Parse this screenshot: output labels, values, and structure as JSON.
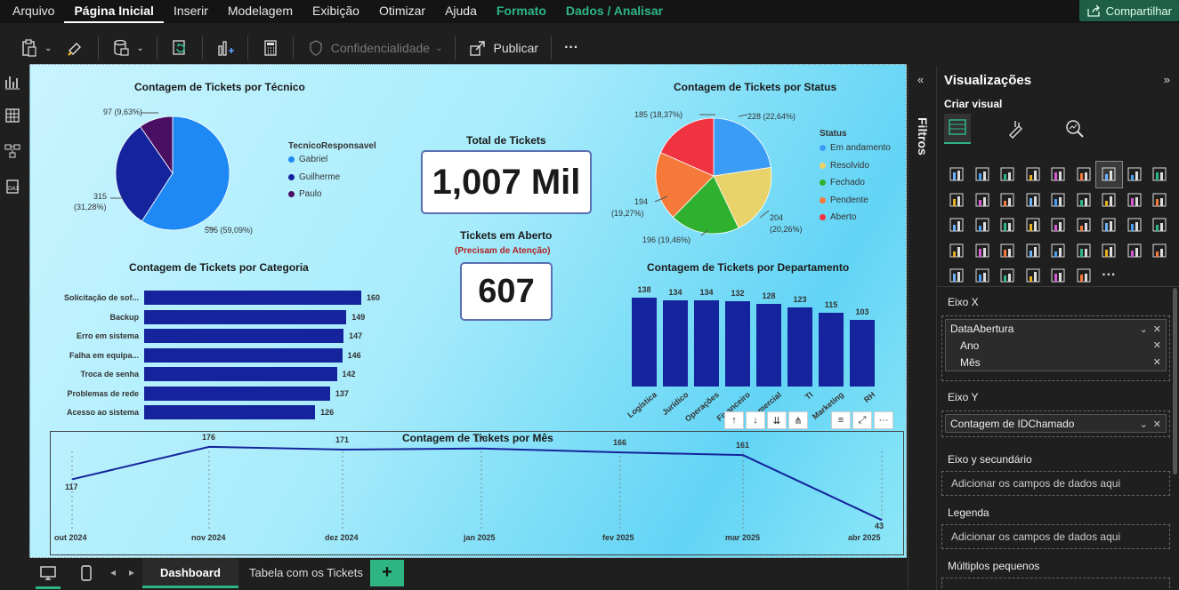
{
  "menu": {
    "items": [
      "Arquivo",
      "Página Inicial",
      "Inserir",
      "Modelagem",
      "Exibição",
      "Otimizar",
      "Ajuda"
    ],
    "active_index": 1,
    "context_items": [
      "Formato",
      "Dados / Analisar"
    ],
    "share_label": "Compartilhar"
  },
  "ribbon": {
    "sensitivity_label": "Confidencialidade",
    "publish_label": "Publicar",
    "more_label": "···"
  },
  "visuals": {
    "tech_pie": {
      "title": "Contagem de Tickets por Técnico",
      "legend_title": "TecnicoResponsavel",
      "slices": [
        {
          "name": "Gabriel",
          "value": 595,
          "label": "595 (59,09%)",
          "color": "#1e88f5"
        },
        {
          "name": "Guilherme",
          "value": 315,
          "label1": "315",
          "label2": "(31,28%)",
          "color": "#15249c"
        },
        {
          "name": "Paulo",
          "value": 97,
          "label": "97 (9,63%)",
          "color": "#4a0f63"
        }
      ]
    },
    "total_card": {
      "title": "Total de Tickets",
      "value": "1,007 Mil"
    },
    "open_card": {
      "title": "Tickets em Aberto",
      "subtitle": "(Precisam de Atenção)",
      "value": "607"
    },
    "status_pie": {
      "title": "Contagem de Tickets por Status",
      "legend_title": "Status",
      "slices": [
        {
          "name": "Em andamento",
          "value": 228,
          "label": "228 (22,64%)",
          "color": "#3b9cf5"
        },
        {
          "name": "Resolvido",
          "value": 204,
          "label1": "204",
          "label2": "(20,26%)",
          "color": "#e8d26a"
        },
        {
          "name": "Fechado",
          "value": 196,
          "label": "196 (19,46%)",
          "color": "#2fb12f"
        },
        {
          "name": "Pendente",
          "value": 194,
          "label1": "194",
          "label2": "(19,27%)",
          "color": "#f57a3a"
        },
        {
          "name": "Aberto",
          "value": 185,
          "label": "185 (18,37%)",
          "color": "#ef3340"
        }
      ]
    },
    "category_bar": {
      "title": "Contagem de Tickets por Categoria",
      "categories": [
        "Solicitação de sof...",
        "Backup",
        "Erro em sistema",
        "Falha em equipa...",
        "Troca de senha",
        "Problemas de rede",
        "Acesso ao sistema"
      ],
      "values": [
        160,
        149,
        147,
        146,
        142,
        137,
        126
      ]
    },
    "dept_bar": {
      "title": "Contagem de Tickets por Departamento",
      "categories": [
        "Logística",
        "Jurídico",
        "Operações",
        "Financeiro",
        "Comercial",
        "TI",
        "Marketing",
        "RH"
      ],
      "values": [
        138,
        134,
        134,
        132,
        128,
        123,
        115,
        103
      ]
    },
    "month_line": {
      "title": "Contagem de Tickets por Mês",
      "months": [
        "out 2024",
        "nov 2024",
        "dez 2024",
        "jan 2025",
        "fev 2025",
        "mar 2025",
        "abr 2025"
      ],
      "values": [
        117,
        176,
        171,
        173,
        166,
        161,
        43
      ]
    }
  },
  "chart_data": [
    {
      "type": "pie",
      "title": "Contagem de Tickets por Técnico",
      "categories": [
        "Gabriel",
        "Guilherme",
        "Paulo"
      ],
      "values": [
        595,
        315,
        97
      ],
      "legend_title": "TecnicoResponsavel",
      "legend": "right"
    },
    {
      "type": "pie",
      "title": "Contagem de Tickets por Status",
      "categories": [
        "Em andamento",
        "Resolvido",
        "Fechado",
        "Pendente",
        "Aberto"
      ],
      "values": [
        228,
        204,
        196,
        194,
        185
      ],
      "legend_title": "Status",
      "legend": "right"
    },
    {
      "type": "bar",
      "orientation": "horizontal",
      "title": "Contagem de Tickets por Categoria",
      "categories": [
        "Solicitação de sof...",
        "Backup",
        "Erro em sistema",
        "Falha em equipa...",
        "Troca de senha",
        "Problemas de rede",
        "Acesso ao sistema"
      ],
      "values": [
        160,
        149,
        147,
        146,
        142,
        137,
        126
      ]
    },
    {
      "type": "bar",
      "title": "Contagem de Tickets por Departamento",
      "categories": [
        "Logística",
        "Jurídico",
        "Operações",
        "Financeiro",
        "Comercial",
        "TI",
        "Marketing",
        "RH"
      ],
      "values": [
        138,
        134,
        134,
        132,
        128,
        123,
        115,
        103
      ]
    },
    {
      "type": "line",
      "title": "Contagem de Tickets por Mês",
      "x": [
        "out 2024",
        "nov 2024",
        "dez 2024",
        "jan 2025",
        "fev 2025",
        "mar 2025",
        "abr 2025"
      ],
      "values": [
        117,
        176,
        171,
        173,
        166,
        161,
        43
      ],
      "grid": "vertical dotted"
    }
  ],
  "colors": {
    "bar": "#15249c",
    "line": "#15249c",
    "accent": "#2fb584"
  },
  "bottom": {
    "tabs": [
      "Dashboard",
      "Tabela com os Tickets"
    ],
    "add_label": "+"
  },
  "filters": {
    "label": "Filtros"
  },
  "viz_pane": {
    "title": "Visualizações",
    "subtitle": "Criar visual",
    "x_axis_label": "Eixo X",
    "x_field": "DataAbertura",
    "x_sub": [
      "Ano",
      "Mês"
    ],
    "y_axis_label": "Eixo Y",
    "y_field": "Contagem de IDChamado",
    "y2_label": "Eixo y secundário",
    "legend_label": "Legenda",
    "add_fields": "Adicionar os campos de dados aqui",
    "small_multiples_label": "Múltiplos pequenos"
  }
}
